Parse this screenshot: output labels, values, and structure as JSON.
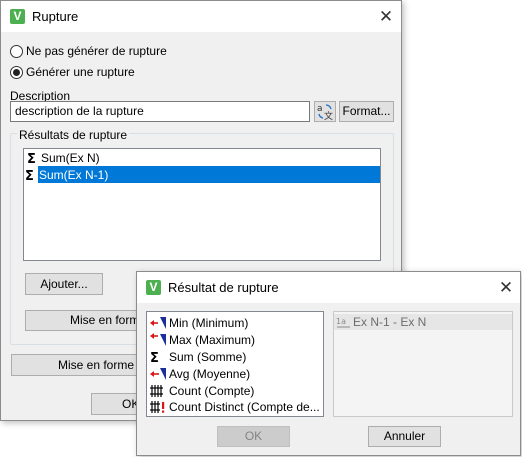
{
  "dialog1": {
    "title": "Rupture",
    "radio_no_break": "Ne pas générer de rupture",
    "radio_break": "Générer une rupture",
    "description_label": "Description",
    "description_value": "description de la rupture",
    "format_button": "Format...",
    "group_title": "Résultats de rupture",
    "results": [
      {
        "icon": "sigma-icon",
        "label": "Sum(Ex N)",
        "selected": false
      },
      {
        "icon": "sigma-icon",
        "label": "Sum(Ex N-1)",
        "selected": true
      }
    ],
    "add_button": "Ajouter...",
    "format_button_partial": "Mise en forme",
    "format_button_partial2": "Mise en forme co",
    "ok_button": "OK"
  },
  "dialog2": {
    "title": "Résultat de rupture",
    "functions": [
      {
        "icon": "min-icon",
        "label": "Min (Minimum)"
      },
      {
        "icon": "max-icon",
        "label": "Max (Maximum)"
      },
      {
        "icon": "sigma-icon",
        "label": "Sum (Somme)"
      },
      {
        "icon": "avg-icon",
        "label": "Avg (Moyenne)"
      },
      {
        "icon": "count-icon",
        "label": "Count (Compte)"
      },
      {
        "icon": "count-distinct-icon",
        "label": "Count Distinct (Compte de..."
      }
    ],
    "right_item": "Ex N-1 - Ex N",
    "right_item_icon": "numeric-field-icon",
    "ok_button": "OK",
    "cancel_button": "Annuler"
  },
  "colors": {
    "selection": "#0078d7",
    "app_icon": "#4caf50"
  }
}
